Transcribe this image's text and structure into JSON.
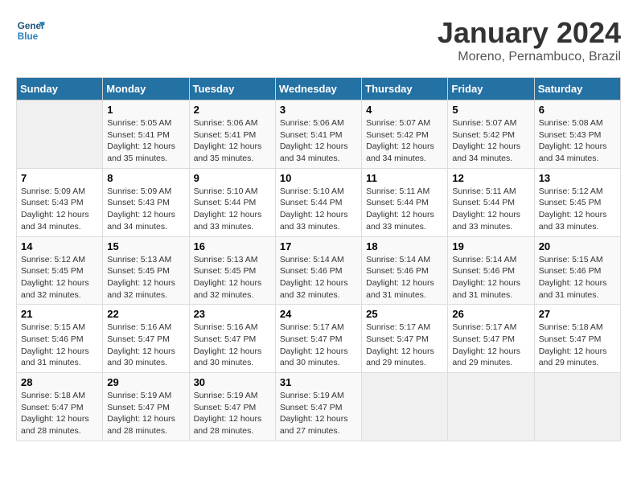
{
  "header": {
    "logo_line1": "General",
    "logo_line2": "Blue",
    "title": "January 2024",
    "subtitle": "Moreno, Pernambuco, Brazil"
  },
  "columns": [
    "Sunday",
    "Monday",
    "Tuesday",
    "Wednesday",
    "Thursday",
    "Friday",
    "Saturday"
  ],
  "weeks": [
    [
      {
        "day": "",
        "sunrise": "",
        "sunset": "",
        "daylight": ""
      },
      {
        "day": "1",
        "sunrise": "Sunrise: 5:05 AM",
        "sunset": "Sunset: 5:41 PM",
        "daylight": "Daylight: 12 hours and 35 minutes."
      },
      {
        "day": "2",
        "sunrise": "Sunrise: 5:06 AM",
        "sunset": "Sunset: 5:41 PM",
        "daylight": "Daylight: 12 hours and 35 minutes."
      },
      {
        "day": "3",
        "sunrise": "Sunrise: 5:06 AM",
        "sunset": "Sunset: 5:41 PM",
        "daylight": "Daylight: 12 hours and 34 minutes."
      },
      {
        "day": "4",
        "sunrise": "Sunrise: 5:07 AM",
        "sunset": "Sunset: 5:42 PM",
        "daylight": "Daylight: 12 hours and 34 minutes."
      },
      {
        "day": "5",
        "sunrise": "Sunrise: 5:07 AM",
        "sunset": "Sunset: 5:42 PM",
        "daylight": "Daylight: 12 hours and 34 minutes."
      },
      {
        "day": "6",
        "sunrise": "Sunrise: 5:08 AM",
        "sunset": "Sunset: 5:43 PM",
        "daylight": "Daylight: 12 hours and 34 minutes."
      }
    ],
    [
      {
        "day": "7",
        "sunrise": "Sunrise: 5:09 AM",
        "sunset": "Sunset: 5:43 PM",
        "daylight": "Daylight: 12 hours and 34 minutes."
      },
      {
        "day": "8",
        "sunrise": "Sunrise: 5:09 AM",
        "sunset": "Sunset: 5:43 PM",
        "daylight": "Daylight: 12 hours and 34 minutes."
      },
      {
        "day": "9",
        "sunrise": "Sunrise: 5:10 AM",
        "sunset": "Sunset: 5:44 PM",
        "daylight": "Daylight: 12 hours and 33 minutes."
      },
      {
        "day": "10",
        "sunrise": "Sunrise: 5:10 AM",
        "sunset": "Sunset: 5:44 PM",
        "daylight": "Daylight: 12 hours and 33 minutes."
      },
      {
        "day": "11",
        "sunrise": "Sunrise: 5:11 AM",
        "sunset": "Sunset: 5:44 PM",
        "daylight": "Daylight: 12 hours and 33 minutes."
      },
      {
        "day": "12",
        "sunrise": "Sunrise: 5:11 AM",
        "sunset": "Sunset: 5:44 PM",
        "daylight": "Daylight: 12 hours and 33 minutes."
      },
      {
        "day": "13",
        "sunrise": "Sunrise: 5:12 AM",
        "sunset": "Sunset: 5:45 PM",
        "daylight": "Daylight: 12 hours and 33 minutes."
      }
    ],
    [
      {
        "day": "14",
        "sunrise": "Sunrise: 5:12 AM",
        "sunset": "Sunset: 5:45 PM",
        "daylight": "Daylight: 12 hours and 32 minutes."
      },
      {
        "day": "15",
        "sunrise": "Sunrise: 5:13 AM",
        "sunset": "Sunset: 5:45 PM",
        "daylight": "Daylight: 12 hours and 32 minutes."
      },
      {
        "day": "16",
        "sunrise": "Sunrise: 5:13 AM",
        "sunset": "Sunset: 5:45 PM",
        "daylight": "Daylight: 12 hours and 32 minutes."
      },
      {
        "day": "17",
        "sunrise": "Sunrise: 5:14 AM",
        "sunset": "Sunset: 5:46 PM",
        "daylight": "Daylight: 12 hours and 32 minutes."
      },
      {
        "day": "18",
        "sunrise": "Sunrise: 5:14 AM",
        "sunset": "Sunset: 5:46 PM",
        "daylight": "Daylight: 12 hours and 31 minutes."
      },
      {
        "day": "19",
        "sunrise": "Sunrise: 5:14 AM",
        "sunset": "Sunset: 5:46 PM",
        "daylight": "Daylight: 12 hours and 31 minutes."
      },
      {
        "day": "20",
        "sunrise": "Sunrise: 5:15 AM",
        "sunset": "Sunset: 5:46 PM",
        "daylight": "Daylight: 12 hours and 31 minutes."
      }
    ],
    [
      {
        "day": "21",
        "sunrise": "Sunrise: 5:15 AM",
        "sunset": "Sunset: 5:46 PM",
        "daylight": "Daylight: 12 hours and 31 minutes."
      },
      {
        "day": "22",
        "sunrise": "Sunrise: 5:16 AM",
        "sunset": "Sunset: 5:47 PM",
        "daylight": "Daylight: 12 hours and 30 minutes."
      },
      {
        "day": "23",
        "sunrise": "Sunrise: 5:16 AM",
        "sunset": "Sunset: 5:47 PM",
        "daylight": "Daylight: 12 hours and 30 minutes."
      },
      {
        "day": "24",
        "sunrise": "Sunrise: 5:17 AM",
        "sunset": "Sunset: 5:47 PM",
        "daylight": "Daylight: 12 hours and 30 minutes."
      },
      {
        "day": "25",
        "sunrise": "Sunrise: 5:17 AM",
        "sunset": "Sunset: 5:47 PM",
        "daylight": "Daylight: 12 hours and 29 minutes."
      },
      {
        "day": "26",
        "sunrise": "Sunrise: 5:17 AM",
        "sunset": "Sunset: 5:47 PM",
        "daylight": "Daylight: 12 hours and 29 minutes."
      },
      {
        "day": "27",
        "sunrise": "Sunrise: 5:18 AM",
        "sunset": "Sunset: 5:47 PM",
        "daylight": "Daylight: 12 hours and 29 minutes."
      }
    ],
    [
      {
        "day": "28",
        "sunrise": "Sunrise: 5:18 AM",
        "sunset": "Sunset: 5:47 PM",
        "daylight": "Daylight: 12 hours and 28 minutes."
      },
      {
        "day": "29",
        "sunrise": "Sunrise: 5:19 AM",
        "sunset": "Sunset: 5:47 PM",
        "daylight": "Daylight: 12 hours and 28 minutes."
      },
      {
        "day": "30",
        "sunrise": "Sunrise: 5:19 AM",
        "sunset": "Sunset: 5:47 PM",
        "daylight": "Daylight: 12 hours and 28 minutes."
      },
      {
        "day": "31",
        "sunrise": "Sunrise: 5:19 AM",
        "sunset": "Sunset: 5:47 PM",
        "daylight": "Daylight: 12 hours and 27 minutes."
      },
      {
        "day": "",
        "sunrise": "",
        "sunset": "",
        "daylight": ""
      },
      {
        "day": "",
        "sunrise": "",
        "sunset": "",
        "daylight": ""
      },
      {
        "day": "",
        "sunrise": "",
        "sunset": "",
        "daylight": ""
      }
    ]
  ]
}
